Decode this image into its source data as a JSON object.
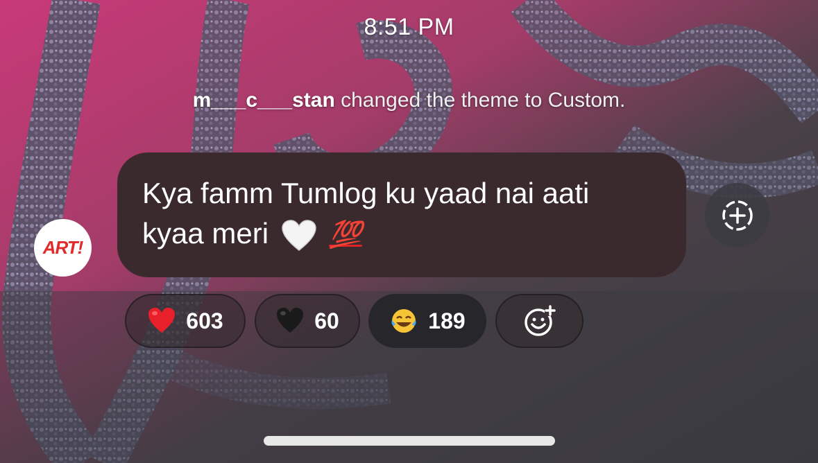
{
  "status": {
    "time": "8:51 PM"
  },
  "system_message": {
    "username": "m___c___stan",
    "text": " changed the theme to Custom."
  },
  "message": {
    "avatar_label": "ART!",
    "line1": "Kya famm Tumlog ku yaad nai aati",
    "line2": "kyaa meri",
    "emoji_1": "white-heart",
    "emoji_2": "💯",
    "share_icon": "add-circle-dashed-icon"
  },
  "reactions": [
    {
      "emoji": "red-heart",
      "count": "603",
      "active": false
    },
    {
      "emoji": "black-heart",
      "count": "60",
      "active": false
    },
    {
      "emoji": "tears-of-joy",
      "count": "189",
      "active": true
    }
  ],
  "add_reaction": {
    "icon": "add-emoji-icon"
  },
  "colors": {
    "bubble": "#3a2a2e",
    "active_pill": "#26262b",
    "hundred_red": "#e02424"
  }
}
